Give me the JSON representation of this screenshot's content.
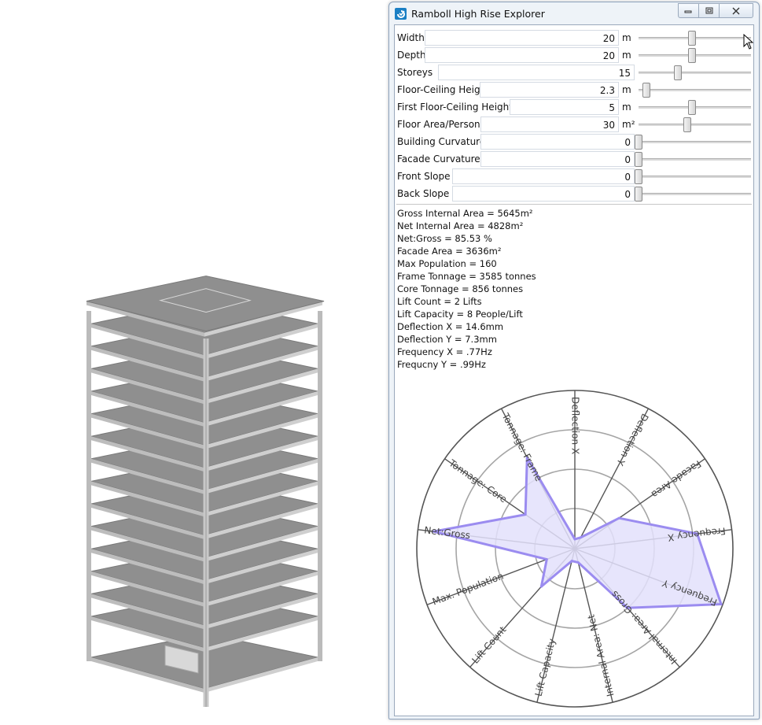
{
  "window": {
    "title": "Ramboll High Rise Explorer",
    "controls": [
      "minimize-icon",
      "maximize-icon",
      "close-icon"
    ]
  },
  "params": [
    {
      "label": "Width",
      "value": "20",
      "unit": "m",
      "slider": 0.49
    },
    {
      "label": "Depth",
      "value": "20",
      "unit": "m",
      "slider": 0.49
    },
    {
      "label": "Storeys",
      "value": "15",
      "unit": "",
      "slider": 0.36
    },
    {
      "label": "Floor-Ceiling Height",
      "value": "2.3",
      "unit": "m",
      "slider": 0.07
    },
    {
      "label": "First Floor-Ceiling Height",
      "value": "5",
      "unit": "m",
      "slider": 0.49
    },
    {
      "label": "Floor Area/Person",
      "value": "30",
      "unit": "m²",
      "slider": 0.45
    },
    {
      "label": "Building Curvature",
      "value": "0",
      "unit": "",
      "slider": 0.0
    },
    {
      "label": "Facade Curvature",
      "value": "0",
      "unit": "",
      "slider": 0.0
    },
    {
      "label": "Front Slope",
      "value": "0",
      "unit": "",
      "slider": 0.0
    },
    {
      "label": "Back Slope",
      "value": "0",
      "unit": "",
      "slider": 0.0
    }
  ],
  "stats": [
    "Gross Internal Area = 5645m²",
    "Net Internal Area = 4828m²",
    "Net:Gross = 85.53 %",
    "Facade Area = 3636m²",
    "Max Population = 160",
    "Frame Tonnage = 3585 tonnes",
    "Core Tonnage = 856 tonnes",
    "Lift Count = 2 Lifts",
    "Lift Capacity = 8 People/Lift",
    "Deflection X = 14.6mm",
    "Deflection Y = 7.3mm",
    "Frequency X = .77Hz",
    "Frequcny Y = .99Hz"
  ],
  "chart_data": {
    "type": "radar",
    "axes": [
      "Deflection X",
      "Deflection Y",
      "Facade Area",
      "Frequency X",
      "Frequency Y",
      "Internal Area: Gross",
      "Internal Area: Net",
      "Lift Capacity",
      "Lift Count",
      "Max. Population",
      "Net:Gross",
      "Tonnage: Core",
      "Tonnage: Frame"
    ],
    "values": [
      0.06,
      0.08,
      0.34,
      0.78,
      0.99,
      0.5,
      0.09,
      0.08,
      0.32,
      0.19,
      0.9,
      0.38,
      0.65
    ],
    "rlim": [
      0,
      1
    ],
    "rings": 4,
    "series_color": "#9b8cf0",
    "fill_color": "#e3e0fb"
  },
  "scene": {
    "storeys": 15
  }
}
